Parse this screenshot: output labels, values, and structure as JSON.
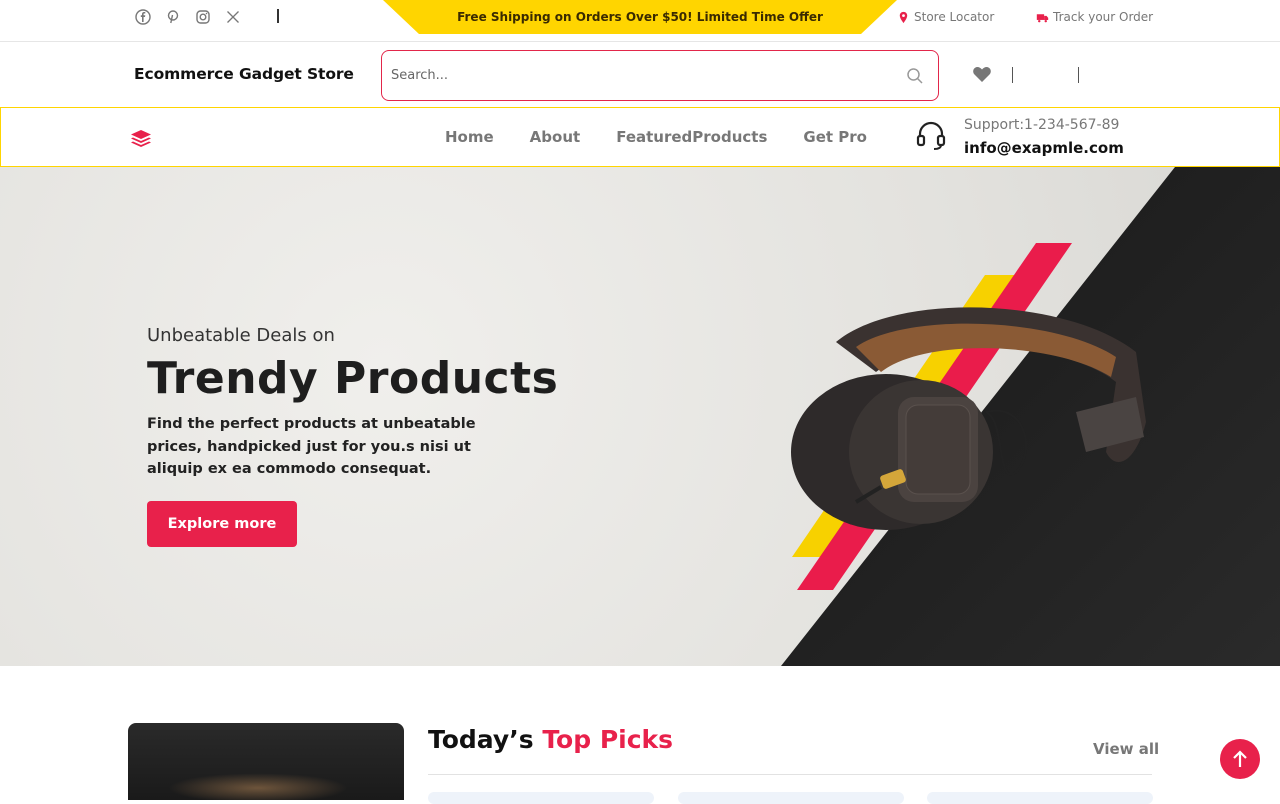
{
  "topbar": {
    "social": [
      "facebook-icon",
      "pinterest-icon",
      "instagram-icon",
      "x-twitter-icon"
    ],
    "promo_text": "Free Shipping on Orders Over $50! Limited Time Offer",
    "store_locator": "Store Locator",
    "track_order": "Track your Order"
  },
  "header": {
    "brand": "Ecommerce Gadget Store",
    "search_placeholder": "Search..."
  },
  "nav": {
    "items": [
      "Home",
      "About",
      "FeaturedProducts",
      "Get Pro"
    ],
    "support_phone": "Support:1-234-567-89",
    "support_email": "info@exapmle.com"
  },
  "hero": {
    "subtitle": "Unbeatable Deals on",
    "title": "Trendy Products",
    "description": "Find the perfect products at unbeatable prices, handpicked just for you.s nisi ut aliquip ex ea commodo consequat.",
    "button": "Explore more"
  },
  "picks": {
    "title_part1": "Today’s",
    "title_part2": "Top Picks",
    "view_all": "View all"
  },
  "colors": {
    "accent": "#e8214b",
    "promo_yellow": "#ffd500",
    "muted": "#777777"
  }
}
